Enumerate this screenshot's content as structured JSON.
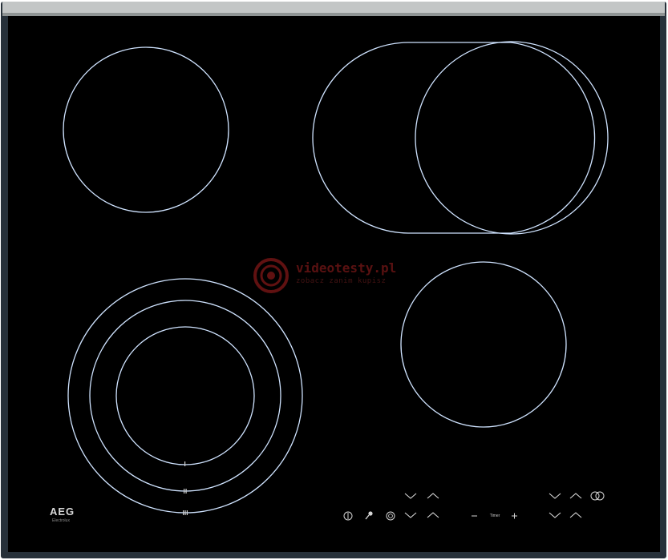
{
  "appliance": {
    "brand": "AEG",
    "brand_subtitle": "Electrolux",
    "colors": {
      "glass": "#000000",
      "frame": "#2a3338",
      "trim_top": "#c9cccc",
      "ring": "#cfe3ff",
      "control_symbol": "#d5d5d5"
    }
  },
  "watermark": {
    "title": "videotesty.pl",
    "tagline": "zobacz zanim kupisz"
  },
  "zones": [
    {
      "name": "front-left-triple-ring-zone",
      "rings": 3,
      "markers": [
        "I",
        "II",
        "III"
      ]
    },
    {
      "name": "rear-left-zone",
      "rings": 1
    },
    {
      "name": "rear-right-oval-zone",
      "rings": 2
    },
    {
      "name": "front-right-zone",
      "rings": 1
    }
  ],
  "controls": {
    "power_icon": "power-icon",
    "key_lock_icon": "key-icon",
    "stop_go_icon": "stopgo-icon",
    "timer": {
      "minus": "−",
      "label": "Timer",
      "plus": "+"
    },
    "down_symbol": "∨",
    "up_symbol": "∧",
    "bridge_icon": "bridge-icon"
  }
}
